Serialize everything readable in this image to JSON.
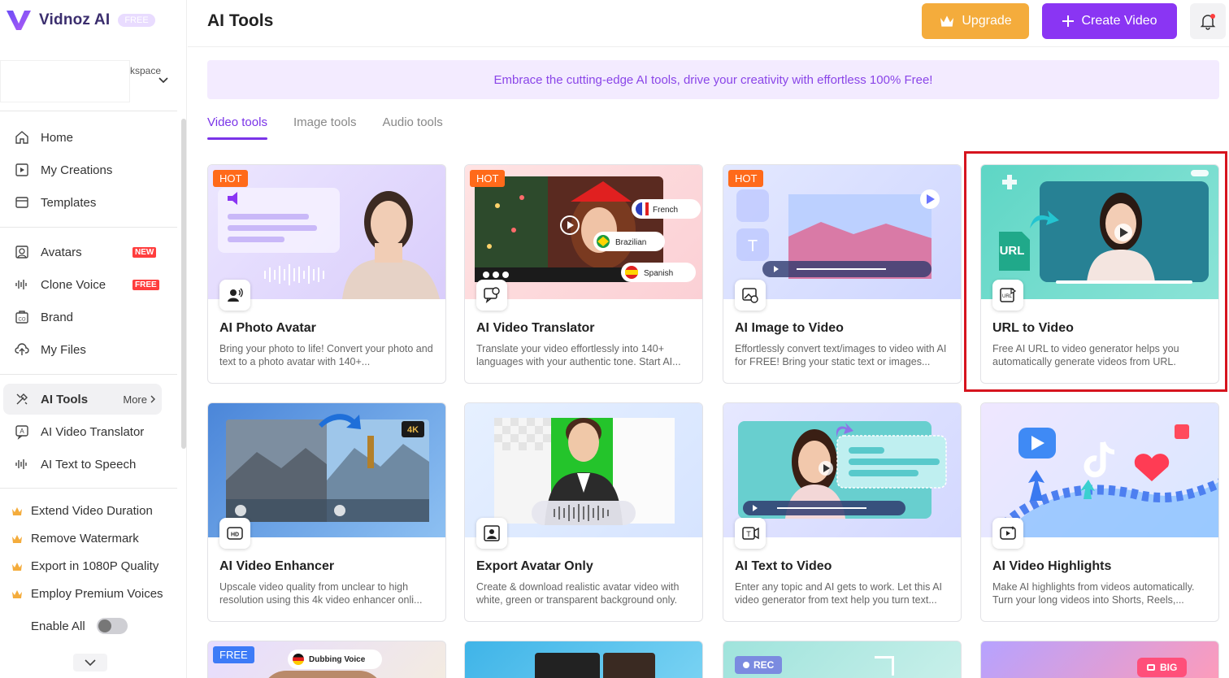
{
  "app": {
    "name": "Vidnoz AI",
    "plan_badge": "FREE"
  },
  "workspace": {
    "label": "kspace"
  },
  "sidebar": {
    "nav": [
      {
        "label": "Home"
      },
      {
        "label": "My Creations"
      },
      {
        "label": "Templates"
      }
    ],
    "nav2": [
      {
        "label": "Avatars",
        "badge": "NEW"
      },
      {
        "label": "Clone Voice",
        "badge": "FREE"
      },
      {
        "label": "Brand"
      },
      {
        "label": "My Files"
      }
    ],
    "tools": [
      {
        "label": "AI Tools",
        "more": "More"
      },
      {
        "label": "AI Video Translator"
      },
      {
        "label": "AI Text to Speech"
      }
    ],
    "premium": [
      {
        "label": "Extend Video Duration"
      },
      {
        "label": "Remove Watermark"
      },
      {
        "label": "Export in 1080P Quality"
      },
      {
        "label": "Employ Premium Voices"
      }
    ],
    "enable_all": "Enable All"
  },
  "header": {
    "title": "AI Tools",
    "upgrade": "Upgrade",
    "create_video": "Create Video"
  },
  "banner": "Embrace the cutting-edge AI tools, drive your creativity with effortless 100% Free!",
  "tabs": [
    {
      "label": "Video tools",
      "active": true
    },
    {
      "label": "Image tools"
    },
    {
      "label": "Audio tools"
    }
  ],
  "cards": [
    {
      "badge": "HOT",
      "title": "AI Photo Avatar",
      "desc": "Bring your photo to life! Convert your photo and text to a photo avatar with 140+..."
    },
    {
      "badge": "HOT",
      "title": "AI Video Translator",
      "desc": "Translate your video effortlessly into 140+ languages with your authentic tone. Start AI...",
      "langs": [
        "French",
        "Brazilian",
        "Spanish"
      ]
    },
    {
      "badge": "HOT",
      "title": "AI Image to Video",
      "desc": "Effortlessly convert text/images to video with AI for FREE! Bring your static text or images..."
    },
    {
      "title": "URL to Video",
      "desc": "Free AI URL to video generator helps you automatically generate videos from URL.",
      "url_tag": "URL"
    },
    {
      "title": "AI Video Enhancer",
      "desc": "Upscale video quality from unclear to high resolution using this 4k video enhancer onli...",
      "tag": "4K"
    },
    {
      "title": "Export Avatar Only",
      "desc": "Create & download realistic avatar video with white, green or transparent background only."
    },
    {
      "title": "AI Text to Video",
      "desc": "Enter any topic and AI gets to work. Let this AI video generator from text help you turn text..."
    },
    {
      "title": "AI Video Highlights",
      "desc": "Make AI highlights from videos automatically. Turn your long videos into Shorts, Reels,..."
    }
  ],
  "partial_cards": [
    {
      "badge": "FREE",
      "label": "Dubbing Voice"
    },
    {},
    {
      "label": "REC"
    },
    {
      "label": "BIG"
    }
  ],
  "colors": {
    "accent": "#8a35f3",
    "upgrade": "#f4ac3c",
    "hot": "#ff6a1a",
    "highlight": "#d6141e"
  }
}
